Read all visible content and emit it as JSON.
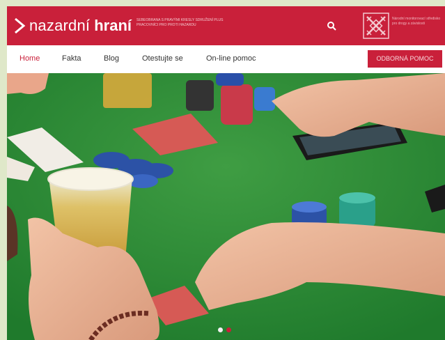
{
  "brand": {
    "name_light": "nazardní",
    "name_bold": "hraní",
    "tagline": "Sebeobrana s pravými kresly sdružení plus Pracovníci pro proti hazardu",
    "partner_text": "Národní monitorovací středisko pro drogy a závislosti",
    "color": "#c9203a"
  },
  "header": {
    "search_icon": "search-icon"
  },
  "nav": {
    "items": [
      {
        "label": "Home",
        "active": true
      },
      {
        "label": "Fakta",
        "active": false
      },
      {
        "label": "Blog",
        "active": false
      },
      {
        "label": "Otestujte se",
        "active": false
      },
      {
        "label": "On-line pomoc",
        "active": false
      }
    ],
    "cta_label": "Odborná pomoc"
  },
  "hero": {
    "slides": 2,
    "active_slide": 2
  }
}
